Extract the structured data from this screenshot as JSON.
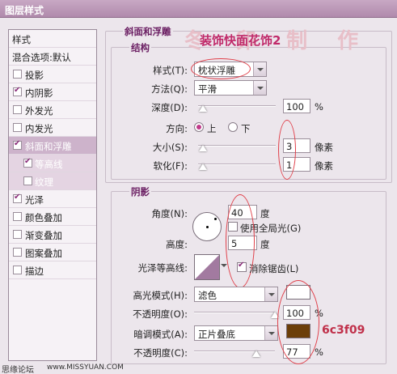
{
  "window": {
    "title": "图层样式"
  },
  "left_panel": {
    "items": [
      {
        "label": "样式",
        "checked": null
      },
      {
        "label": "混合选项:默认",
        "checked": null
      },
      {
        "label": "投影",
        "checked": false
      },
      {
        "label": "内阴影",
        "checked": true
      },
      {
        "label": "外发光",
        "checked": false
      },
      {
        "label": "内发光",
        "checked": false
      },
      {
        "label": "斜面和浮雕",
        "checked": true
      },
      {
        "label": "等高线",
        "checked": true
      },
      {
        "label": "纹理",
        "checked": false
      },
      {
        "label": "光泽",
        "checked": true
      },
      {
        "label": "颜色叠加",
        "checked": false
      },
      {
        "label": "渐变叠加",
        "checked": false
      },
      {
        "label": "图案叠加",
        "checked": false
      },
      {
        "label": "描边",
        "checked": false
      }
    ]
  },
  "bevel": {
    "section_title": "斜面和浮雕",
    "structure_title": "结构",
    "style_label": "样式(T):",
    "style_value": "枕状浮雕",
    "technique_label": "方法(Q):",
    "technique_value": "平滑",
    "depth_label": "深度(D):",
    "depth_value": "100",
    "depth_unit": "%",
    "direction_label": "方向:",
    "dir_up": "上",
    "dir_down": "下",
    "direction_selected": "上",
    "size_label": "大小(S):",
    "size_value": "3",
    "size_unit": "像素",
    "soften_label": "软化(F):",
    "soften_value": "1",
    "soften_unit": "像素"
  },
  "shading": {
    "title": "阴影",
    "angle_label": "角度(N):",
    "angle_value": "40",
    "angle_unit": "度",
    "global_light_label": "使用全局光(G)",
    "global_light_checked": false,
    "altitude_label": "高度:",
    "altitude_value": "5",
    "altitude_unit": "度",
    "gloss_contour_label": "光泽等高线:",
    "antialias_label": "消除锯齿(L)",
    "antialias_checked": true,
    "highlight_mode_label": "高光模式(H):",
    "highlight_mode_value": "滤色",
    "highlight_color": "#ffffff",
    "highlight_opacity_label": "不透明度(O):",
    "highlight_opacity_value": "100",
    "highlight_opacity_unit": "%",
    "shadow_mode_label": "暗调模式(A):",
    "shadow_mode_value": "正片叠底",
    "shadow_color": "#6c3f09",
    "shadow_opacity_label": "不透明度(C):",
    "shadow_opacity_value": "77",
    "shadow_opacity_unit": "%"
  },
  "overlay": {
    "watermark_text": "装饰快面花饰2",
    "watermark_faint": "冬 卯 制 作",
    "color_note": "6c3f09",
    "footer_left": "思缘论坛",
    "footer_url": "www.MISSYUAN.COM"
  },
  "colors": {
    "accent": "#6b1f63",
    "annotation": "#e0404a",
    "selected_bg": "#cdb3cb"
  }
}
